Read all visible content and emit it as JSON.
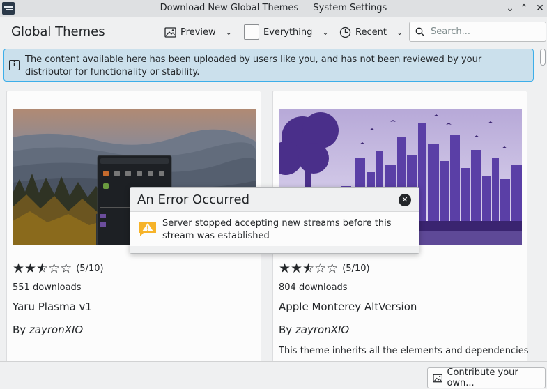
{
  "window": {
    "title": "Download New Global Themes — System Settings",
    "app_icon": "kde-settings-icon"
  },
  "toolbar": {
    "page_title": "Global Themes",
    "view_mode": "Preview",
    "filter": "Everything",
    "sort": "Recent",
    "search_placeholder": "Search..."
  },
  "banner": {
    "text": "The content available here has been uploaded by users like you, and has not been reviewed by your distributor for functionality or stability."
  },
  "themes": [
    {
      "rating_text": "(5/10)",
      "rating_stars": 2.5,
      "downloads": "551 downloads",
      "name": "Yaru Plasma v1",
      "by": "By ",
      "author": "zayronXIO",
      "description": ""
    },
    {
      "rating_text": "(5/10)",
      "rating_stars": 2.5,
      "downloads": "804 downloads",
      "name": "Apple Monterey AltVersion",
      "by": "By ",
      "author": "zayronXIO",
      "description": "This theme inherits all the elements and dependencies"
    }
  ],
  "dialog": {
    "title": "An Error Occurred",
    "message": "Server stopped accepting new streams before this stream was established"
  },
  "bottom": {
    "contribute_label": "Contribute your own..."
  },
  "colors": {
    "accent": "#3daee9",
    "banner_bg": "#cbe0ec",
    "warning": "#f6b329"
  }
}
